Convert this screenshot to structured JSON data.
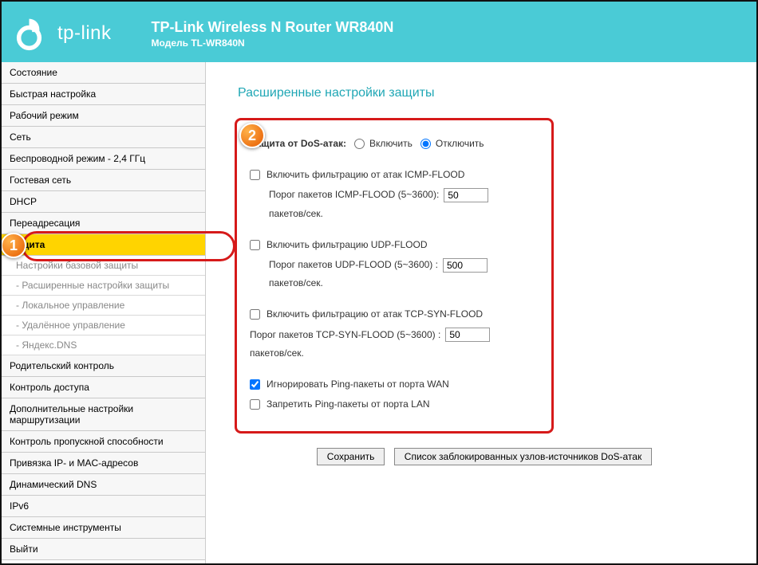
{
  "header": {
    "brand": "tp-link",
    "title": "TP-Link Wireless N Router WR840N",
    "subtitle": "Модель TL-WR840N"
  },
  "sidebar": {
    "items": [
      "Состояние",
      "Быстрая настройка",
      "Рабочий режим",
      "Сеть",
      "Беспроводной режим - 2,4 ГГц",
      "Гостевая сеть",
      "DHCP",
      "Переадресация"
    ],
    "active": "Защита",
    "sub": [
      "Настройки базовой защиты",
      "- Расширенные настройки защиты",
      "- Локальное управление",
      "- Удалённое управление",
      "- Яндекс.DNS"
    ],
    "items2": [
      "Родительский контроль",
      "Контроль доступа",
      "Дополнительные настройки маршрутизации",
      "Контроль пропускной способности",
      "Привязка IP- и MAC-адресов",
      "Динамический DNS",
      "IPv6",
      "Системные инструменты",
      "Выйти"
    ]
  },
  "content": {
    "page_title": "Расширенные настройки защиты",
    "dos": {
      "label": "Защита от DoS-атак:",
      "enable": "Включить",
      "disable": "Отключить",
      "enable_checked": false,
      "disable_checked": true
    },
    "icmp": {
      "cb_label": "Включить фильтрацию от атак ICMP-FLOOD",
      "checked": false,
      "threshold_label": "Порог пакетов ICMP-FLOOD (5~3600):",
      "value": "50",
      "unit": "пакетов/сек."
    },
    "udp": {
      "cb_label": "Включить фильтрацию UDP-FLOOD",
      "checked": false,
      "threshold_label": "Порог пакетов UDP-FLOOD (5~3600) :",
      "value": "500",
      "unit": "пакетов/сек."
    },
    "tcp": {
      "cb_label": "Включить фильтрацию от атак TCP-SYN-FLOOD",
      "checked": false,
      "threshold_label": "Порог пакетов TCP-SYN-FLOOD (5~3600) :",
      "value": "50",
      "unit": "пакетов/сек."
    },
    "wan_ping": {
      "label": "Игнорировать Ping-пакеты от порта WAN",
      "checked": true
    },
    "lan_ping": {
      "label": "Запретить Ping-пакеты от порта LAN",
      "checked": false
    },
    "buttons": {
      "save": "Сохранить",
      "blocked_list": "Список заблокированных узлов-источников DoS-атак"
    }
  },
  "callouts": {
    "c1": "1",
    "c2": "2"
  }
}
